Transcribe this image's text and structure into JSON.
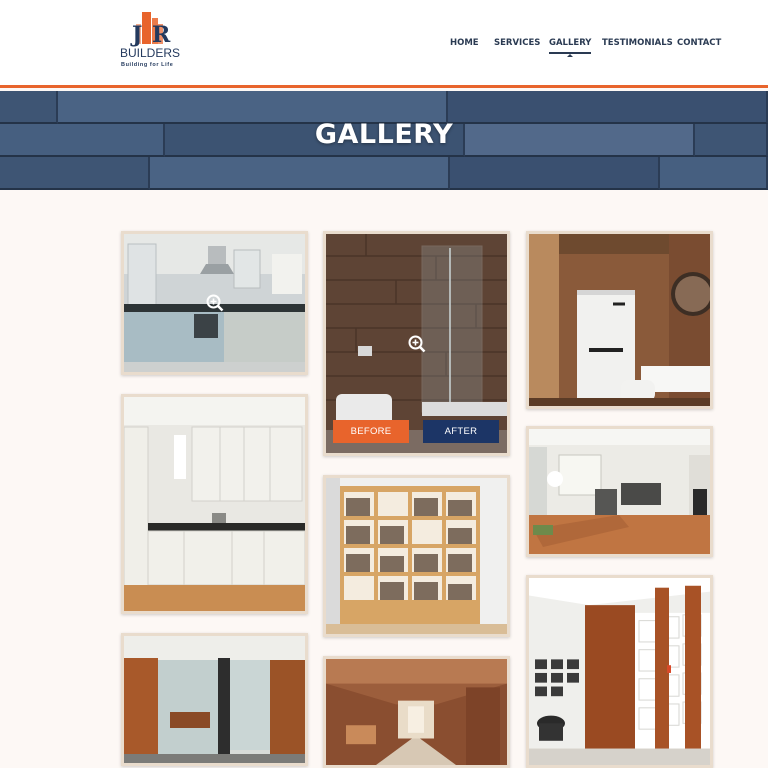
{
  "brand": {
    "name_top": "JR",
    "name": "BUILDERS",
    "tagline": "Building for Life",
    "accent": "#e8642c",
    "navy": "#243a5e"
  },
  "nav": {
    "items": [
      {
        "label": "HOME",
        "active": false
      },
      {
        "label": "SERVICES",
        "active": false
      },
      {
        "label": "GALLERY",
        "active": true
      },
      {
        "label": "TESTIMONIALS",
        "active": false
      },
      {
        "label": "CONTACT",
        "active": false
      }
    ]
  },
  "banner": {
    "title": "GALLERY"
  },
  "gallery": {
    "before_label": "BEFORE",
    "after_label": "AFTER",
    "zoom_icon": "zoom-in-icon",
    "items": [
      {
        "subject": "kitchen-blue-cabinets"
      },
      {
        "subject": "bathroom-wood-shower"
      },
      {
        "subject": "bathroom-wood-walls"
      },
      {
        "subject": "kitchen-white-cabinets"
      },
      {
        "subject": "bookshelves"
      },
      {
        "subject": "dining-living-room"
      },
      {
        "subject": "office-glass-partitions"
      },
      {
        "subject": "wood-corridor"
      },
      {
        "subject": "living-room-shelving"
      }
    ]
  }
}
